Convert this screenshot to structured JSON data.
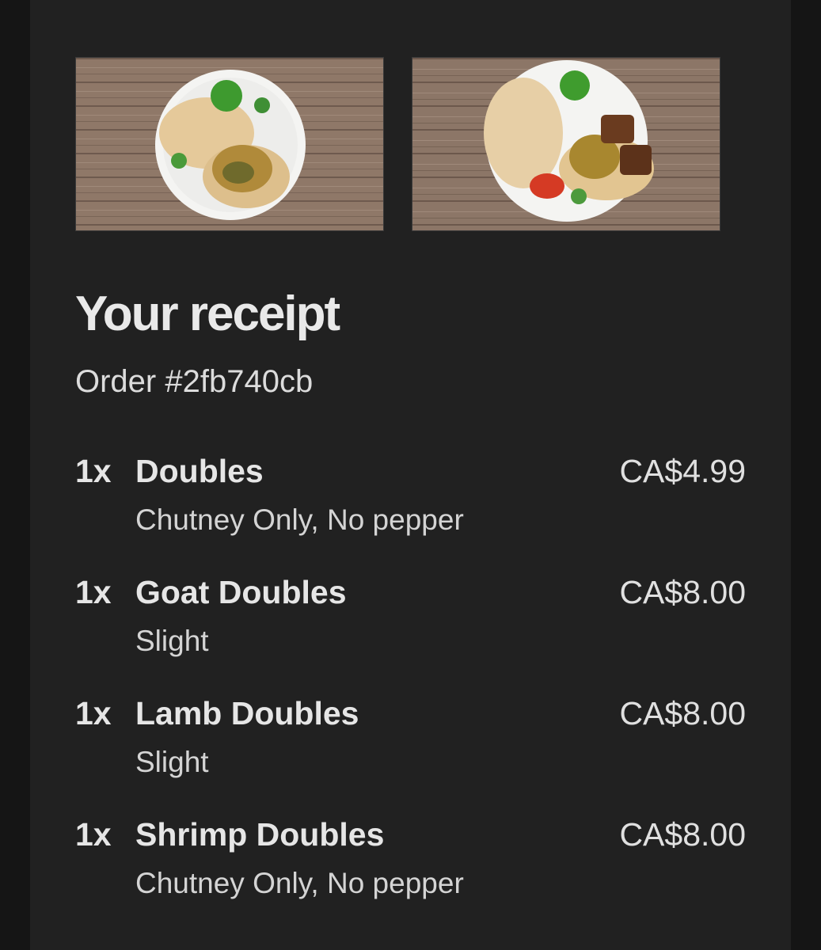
{
  "receipt": {
    "title": "Your receipt",
    "order_number": "Order #2fb740cb"
  },
  "photos": [
    {
      "icon": "food-photo-doubles-plate"
    },
    {
      "icon": "food-photo-doubles-with-meat-plate"
    }
  ],
  "items": [
    {
      "qty": "1x",
      "name": "Doubles",
      "price": "CA$4.99",
      "modifiers": "Chutney Only, No pepper"
    },
    {
      "qty": "1x",
      "name": "Goat Doubles",
      "price": "CA$8.00",
      "modifiers": "Slight"
    },
    {
      "qty": "1x",
      "name": "Lamb Doubles",
      "price": "CA$8.00",
      "modifiers": "Slight"
    },
    {
      "qty": "1x",
      "name": "Shrimp Doubles",
      "price": "CA$8.00",
      "modifiers": "Chutney Only, No pepper"
    }
  ],
  "colors": {
    "background": "#212121",
    "text": "#e6e6e6",
    "wood": "#8c7566"
  }
}
